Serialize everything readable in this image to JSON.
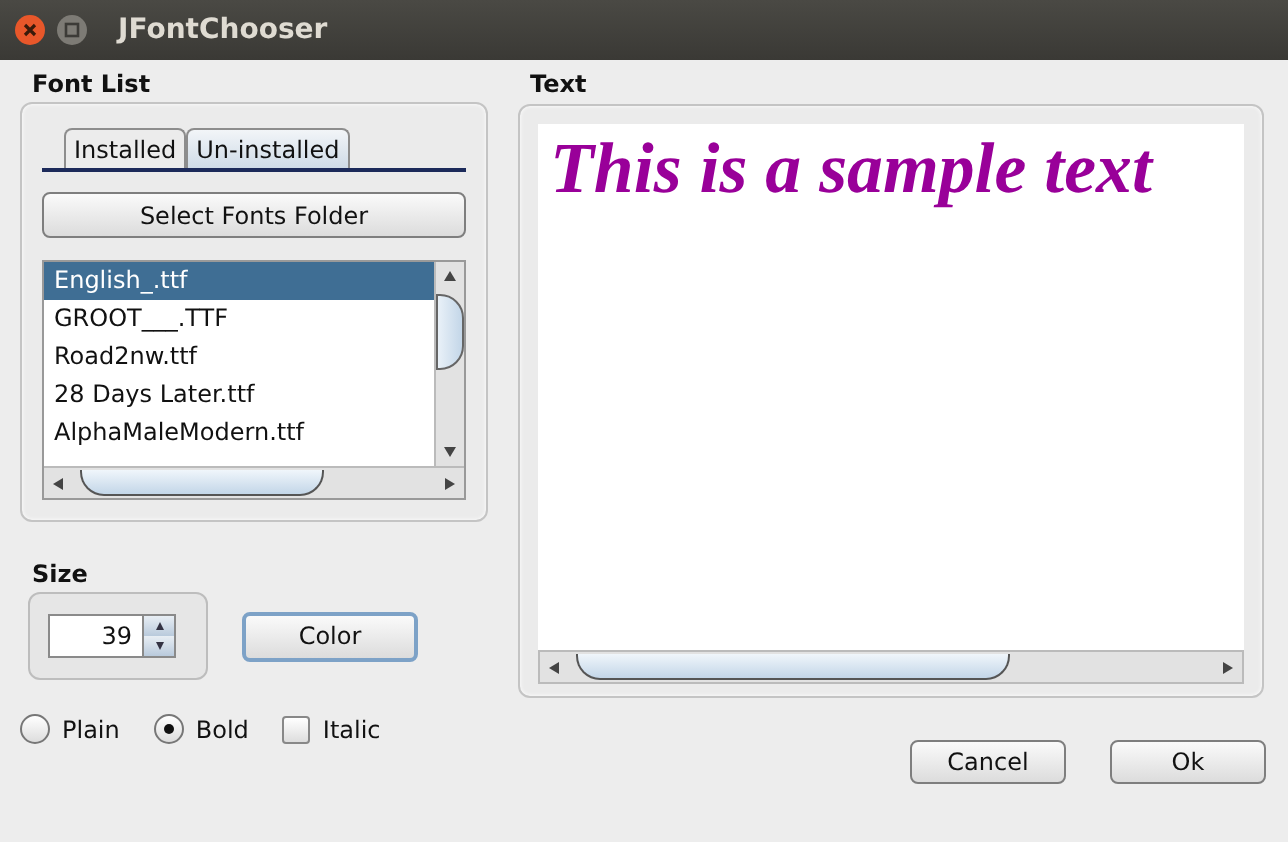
{
  "window": {
    "title": "JFontChooser"
  },
  "font_list": {
    "label": "Font List",
    "tabs": [
      {
        "label": "Installed",
        "selected": false
      },
      {
        "label": "Un-installed",
        "selected": true
      }
    ],
    "folder_button": "Select Fonts Folder",
    "fonts": [
      {
        "name": "English_.ttf",
        "selected": true
      },
      {
        "name": "GROOT___.TTF",
        "selected": false
      },
      {
        "name": "Road2nw.ttf",
        "selected": false
      },
      {
        "name": "28 Days Later.ttf",
        "selected": false
      },
      {
        "name": "AlphaMaleModern.ttf",
        "selected": false
      }
    ]
  },
  "size": {
    "label": "Size",
    "value": "39"
  },
  "color_button": "Color",
  "styles": [
    {
      "kind": "radio",
      "label": "Plain",
      "checked": false
    },
    {
      "kind": "radio",
      "label": "Bold",
      "checked": true
    },
    {
      "kind": "checkbox",
      "label": "Italic",
      "checked": false
    }
  ],
  "preview": {
    "label": "Text",
    "sample": "This is a sample text"
  },
  "buttons": [
    "Cancel",
    "Ok"
  ]
}
